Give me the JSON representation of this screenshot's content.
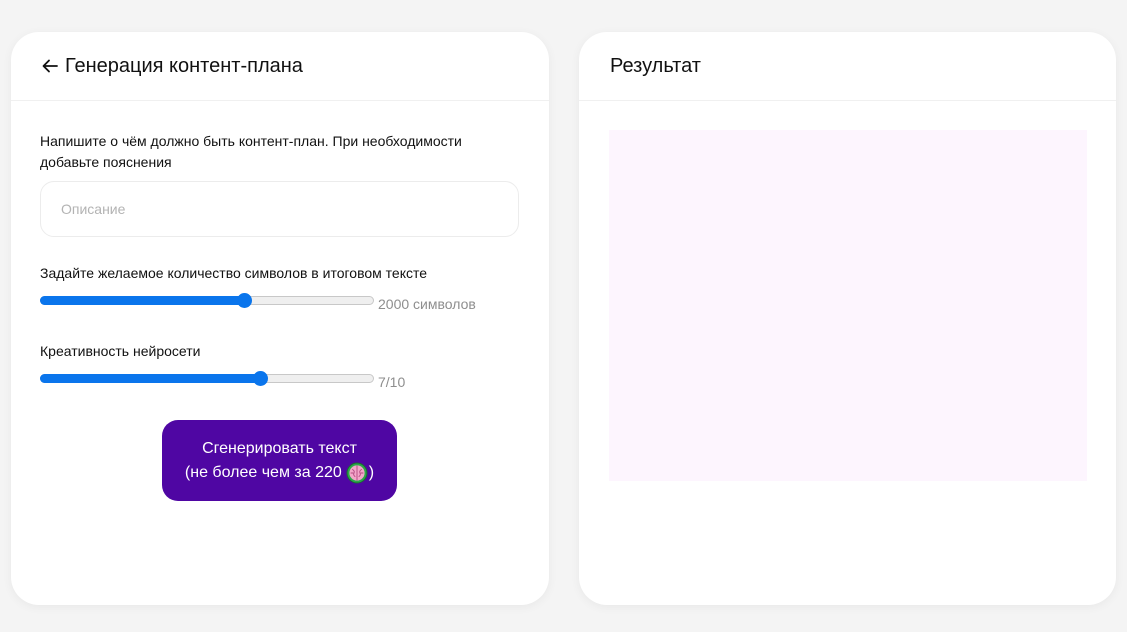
{
  "left_panel": {
    "title": "Генерация контент-плана",
    "description_label_line1": "Напишите о чём должно быть контент-план. При необходимости",
    "description_label_line2": "добавьте пояснения",
    "description_input": {
      "value": "",
      "placeholder": "Описание"
    },
    "length_slider": {
      "label": "Задайте желаемое количество символов в итоговом тексте",
      "value_text": "2000 символов",
      "fraction": 0.61
    },
    "creativity_slider": {
      "label": "Креативность нейросети",
      "value_text": "7/10",
      "fraction": 0.66
    },
    "generate_button": {
      "line1": "Сгенерировать текст",
      "line2_prefix": "(не более чем за 220",
      "line2_suffix": ")"
    }
  },
  "right_panel": {
    "title": "Результат",
    "result_text": ""
  },
  "colors": {
    "accent_blue": "#0a75ec",
    "button_purple": "#4f06a3",
    "result_bg": "#fdf5fe",
    "page_bg": "#f4f4f4"
  },
  "icons": {
    "back": "arrow-left-icon",
    "token": "brain-icon"
  }
}
